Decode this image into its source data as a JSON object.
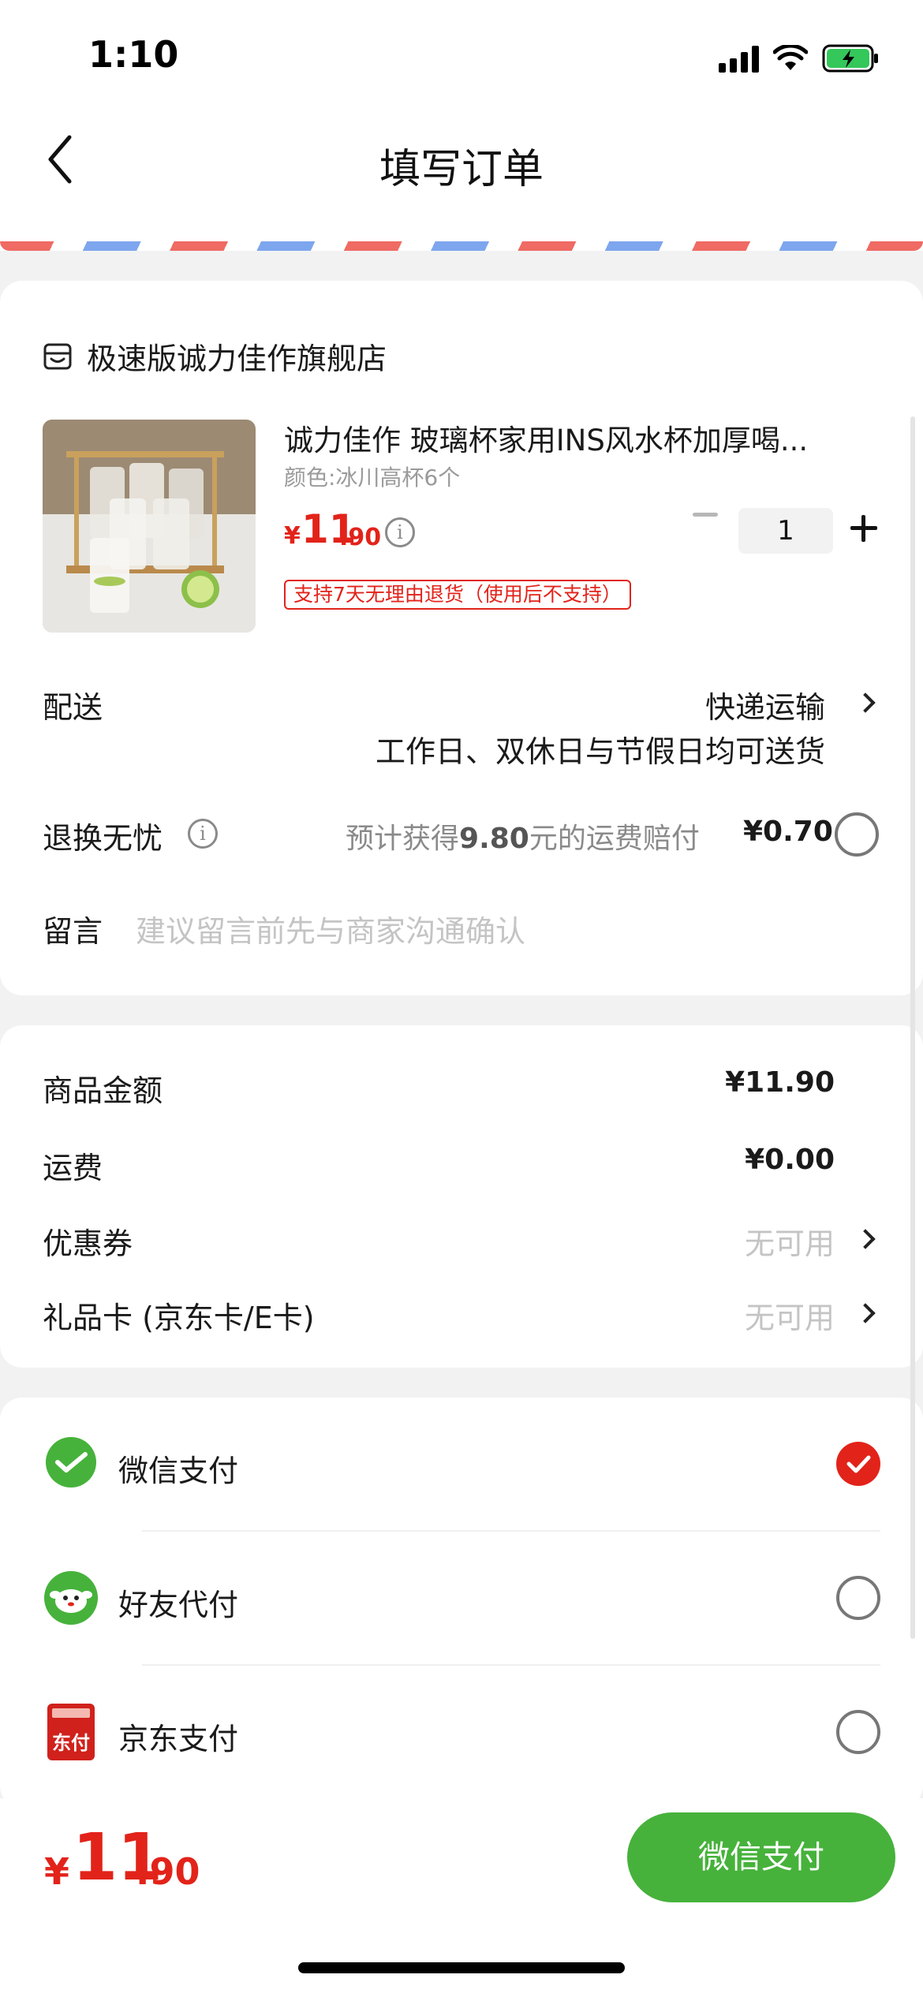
{
  "status_bar": {
    "time": "1:10"
  },
  "nav": {
    "title": "填写订单"
  },
  "product": {
    "shop_name": "极速版诚力佳作旗舰店",
    "title": "诚力佳作 玻璃杯家用INS风水杯加厚喝...",
    "spec": "颜色:冰川高杯6个",
    "price_symbol": "¥",
    "price_int": "11",
    "price_dec": ".90",
    "quantity": "1",
    "return_tag": "支持7天无理由退货（使用后不支持）"
  },
  "delivery": {
    "label": "配送",
    "method": "快递运输",
    "note": "工作日、双休日与节假日均可送货"
  },
  "return_insurance": {
    "label": "退换无忧",
    "desc_prefix": "预计获得",
    "desc_amount": "9.80",
    "desc_suffix": "元的运费赔付",
    "price": "¥0.70"
  },
  "message": {
    "label": "留言",
    "placeholder": "建议留言前先与商家沟通确认"
  },
  "summary": {
    "goods_label": "商品金额",
    "goods_value": "¥11.90",
    "shipping_label": "运费",
    "shipping_value": "¥0.00",
    "coupon_label": "优惠券",
    "coupon_value": "无可用",
    "giftcard_label": "礼品卡 (京东卡/E卡)",
    "giftcard_value": "无可用"
  },
  "payment": {
    "methods": [
      {
        "label": "微信支付",
        "icon": "wechat-pay-icon",
        "selected": true
      },
      {
        "label": "好友代付",
        "icon": "friend-pay-icon",
        "selected": false
      },
      {
        "label": "京东支付",
        "icon": "jd-pay-icon",
        "icon_text": "东付",
        "selected": false
      }
    ]
  },
  "footer": {
    "total_symbol": "¥",
    "total_int": "11",
    "total_dec": ".90",
    "pay_button": "微信支付"
  },
  "colors": {
    "accent_red": "#e2231a",
    "wechat_green": "#46b23b",
    "stripe_red": "#ef6b63",
    "stripe_blue": "#7ea6ee"
  }
}
